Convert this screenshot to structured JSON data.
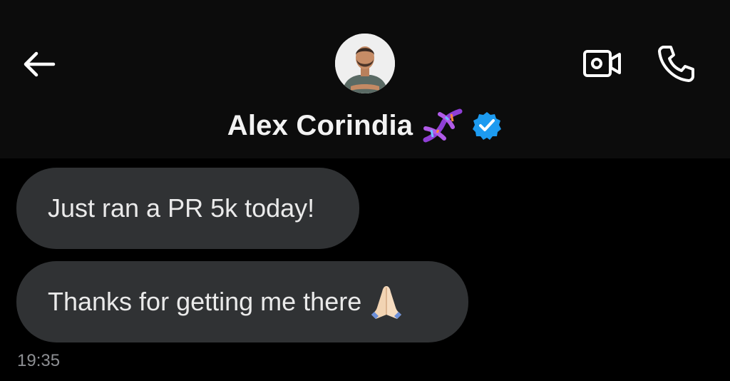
{
  "header": {
    "back_icon": "arrow-left-icon",
    "avatar_icon": "profile-avatar",
    "video_icon": "video-camera-icon",
    "call_icon": "phone-icon",
    "contact_name": "Alex Corindia",
    "name_emoji_icon": "dna-emoji-icon",
    "verified_icon": "verified-badge-icon",
    "verified_color": "#1d9bf0"
  },
  "messages": [
    {
      "text": "Just ran a PR 5k today!"
    },
    {
      "text": "Thanks for getting me there",
      "emoji_icon": "folded-hands-emoji-icon"
    }
  ],
  "timestamp": "19:35",
  "colors": {
    "background": "#000000",
    "header_background": "#0c0c0c",
    "bubble": "#303234",
    "timestamp": "#8d8f93"
  }
}
